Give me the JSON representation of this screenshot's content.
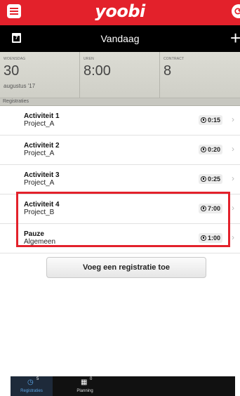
{
  "appbar": {
    "logo": "yoobi",
    "sync_icon": "sync-icon",
    "menu_icon": "hamburger-menu-icon",
    "accent": "#e3212b"
  },
  "datebar": {
    "calendar_day": "7",
    "title": "Vandaag",
    "add_label": "+"
  },
  "stats": {
    "day": {
      "label": "WOENSDAG",
      "value": "30",
      "sub": "augustus '17"
    },
    "hours": {
      "label": "UREN",
      "value": "8:00"
    },
    "contract": {
      "label": "CONTRACT",
      "value": "8"
    }
  },
  "section": {
    "title": "Registraties"
  },
  "registrations": [
    {
      "title": "Activiteit 1",
      "project": "Project_A",
      "duration": "0:15"
    },
    {
      "title": "Activiteit 2",
      "project": "Project_A",
      "duration": "0:20"
    },
    {
      "title": "Activiteit 3",
      "project": "Project_A",
      "duration": "0:25"
    },
    {
      "title": "Activiteit 4",
      "project": "Project_B",
      "duration": "7:00"
    },
    {
      "title": "Pauze",
      "project": "Algemeen",
      "duration": "1:00"
    }
  ],
  "add_registration_label": "Voeg een registratie toe",
  "tabs": [
    {
      "label": "Registraties",
      "badge": "5",
      "icon": "clock-icon",
      "active": true
    },
    {
      "label": "Planning",
      "badge": "0",
      "icon": "calendar-icon",
      "active": false
    }
  ]
}
